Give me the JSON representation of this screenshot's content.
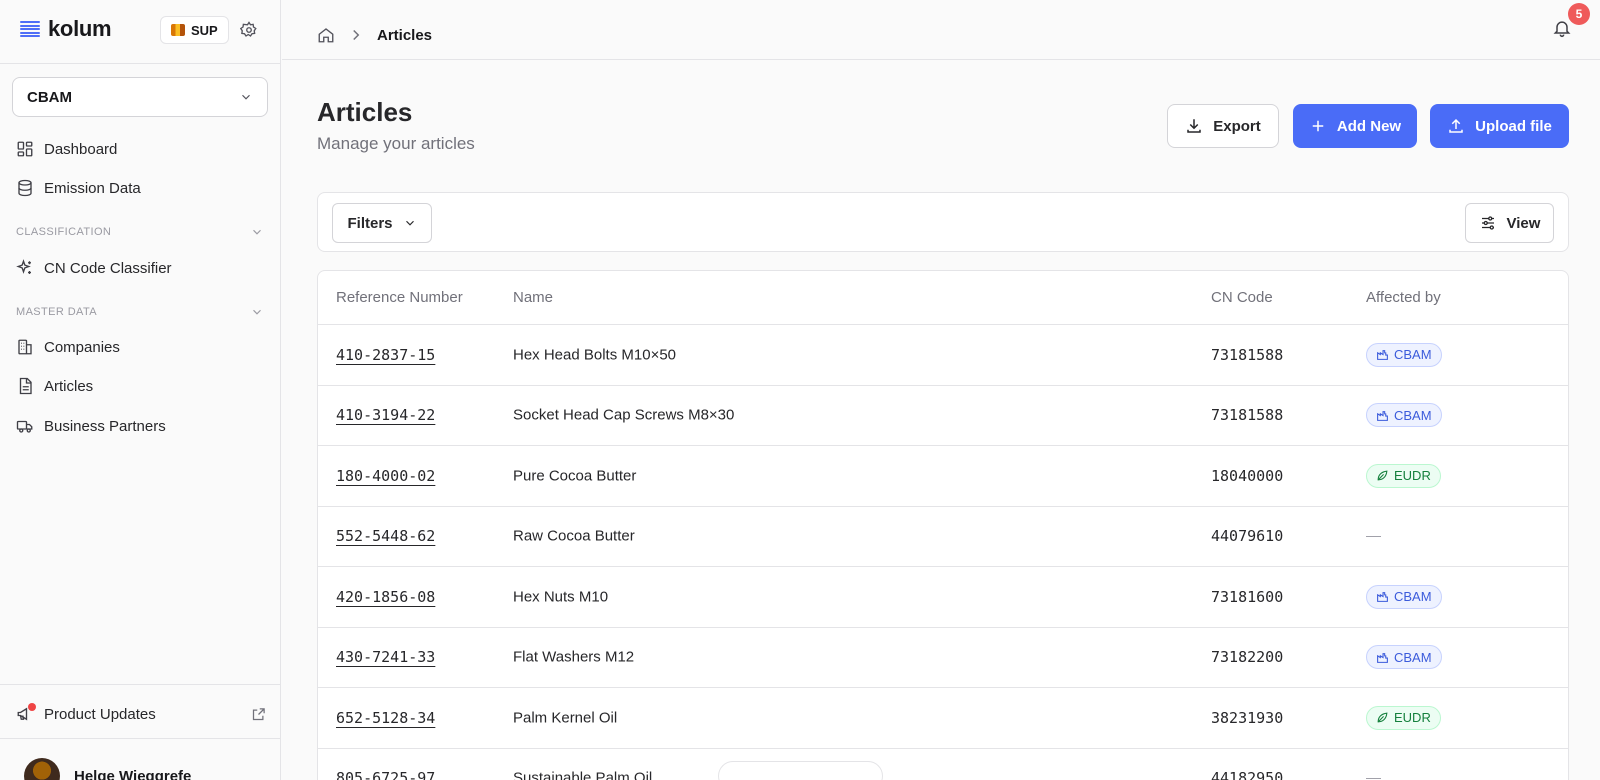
{
  "brand": {
    "name": "kolum",
    "org": "SUP"
  },
  "workspace": {
    "selected": "CBAM"
  },
  "sidebar": {
    "items_top": [
      {
        "label": "Dashboard",
        "icon": "dashboard-icon"
      },
      {
        "label": "Emission Data",
        "icon": "database-icon"
      }
    ],
    "sections": [
      {
        "title": "CLASSIFICATION",
        "items": [
          {
            "label": "CN Code Classifier",
            "icon": "sparkles-icon"
          }
        ]
      },
      {
        "title": "MASTER DATA",
        "items": [
          {
            "label": "Companies",
            "icon": "building-icon"
          },
          {
            "label": "Articles",
            "icon": "file-icon"
          },
          {
            "label": "Business Partners",
            "icon": "truck-icon"
          }
        ]
      }
    ],
    "updates_label": "Product Updates",
    "user_name": "Helge Wieggrefe"
  },
  "header": {
    "breadcrumb": "Articles",
    "notifications": "5"
  },
  "page": {
    "title": "Articles",
    "subtitle": "Manage your articles",
    "export_label": "Export",
    "add_label": "Add New",
    "upload_label": "Upload file",
    "filters_label": "Filters",
    "view_label": "View"
  },
  "table": {
    "columns": [
      "Reference Number",
      "Name",
      "CN Code",
      "Affected by"
    ],
    "rows": [
      {
        "ref": "410-2837-15",
        "name": "Hex Head Bolts M10×50",
        "code": "73181588",
        "affected": "CBAM"
      },
      {
        "ref": "410-3194-22",
        "name": "Socket Head Cap Screws M8×30",
        "code": "73181588",
        "affected": "CBAM"
      },
      {
        "ref": "180-4000-02",
        "name": "Pure Cocoa Butter",
        "code": "18040000",
        "affected": "EUDR"
      },
      {
        "ref": "552-5448-62",
        "name": "Raw Cocoa Butter",
        "code": "44079610",
        "affected": "—"
      },
      {
        "ref": "420-1856-08",
        "name": "Hex Nuts M10",
        "code": "73181600",
        "affected": "CBAM"
      },
      {
        "ref": "430-7241-33",
        "name": "Flat Washers M12",
        "code": "73182200",
        "affected": "CBAM"
      },
      {
        "ref": "652-5128-34",
        "name": "Palm Kernel Oil",
        "code": "38231930",
        "affected": "EUDR"
      },
      {
        "ref": "805-6725-97",
        "name": "Sustainable Palm Oil",
        "code": "44182950",
        "affected": "—"
      }
    ]
  },
  "colors": {
    "accent": "#4a6cf7",
    "cbam": "#3b5bdb",
    "eudr": "#15803d",
    "alert": "#ef4444"
  }
}
